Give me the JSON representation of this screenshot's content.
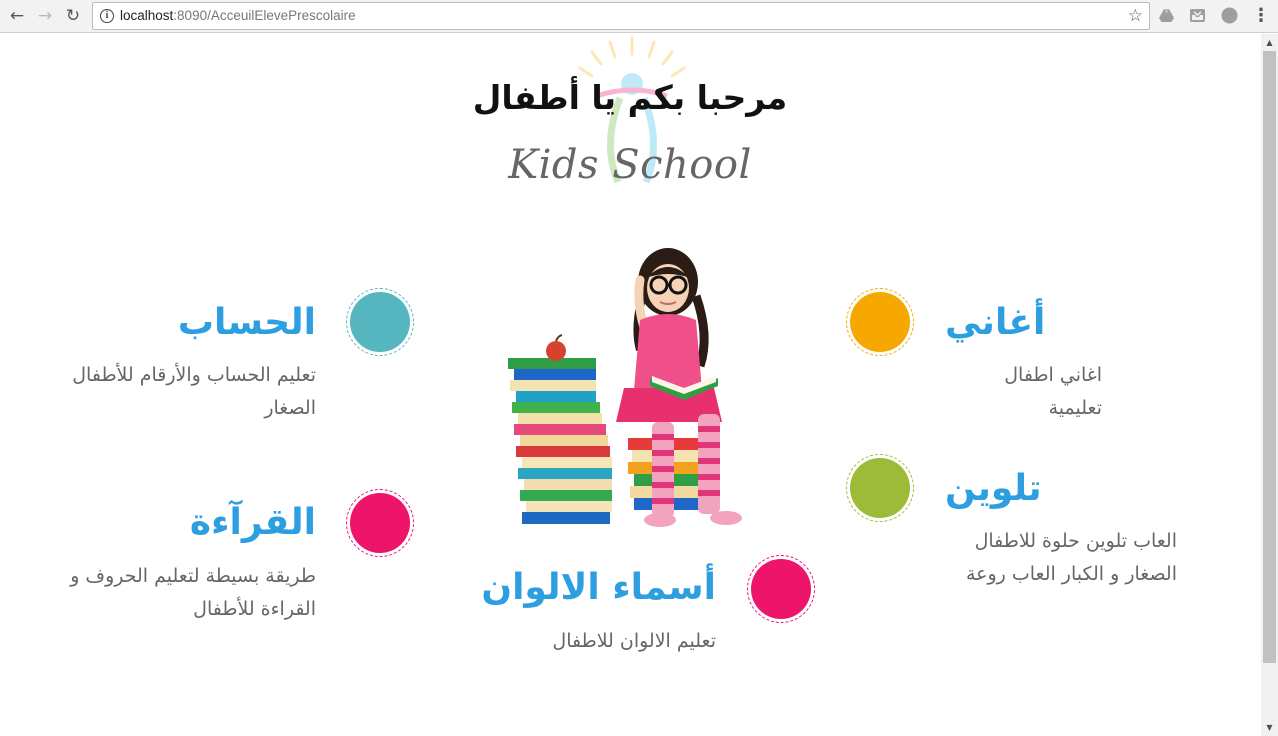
{
  "browser": {
    "url_host": "localhost",
    "url_path": ":8090/AcceuilElevePrescolaire"
  },
  "header": {
    "welcome": "مرحبا بكم يا أطفال",
    "brand": "Kids School"
  },
  "features": {
    "math": {
      "title": "الحساب",
      "desc_line1": "تعليم الحساب والأرقام للأطفال",
      "desc_line2": "الصغار",
      "color": "#56b6c0"
    },
    "reading": {
      "title": "القرآءة",
      "desc_line1": "طريقة بسيطة لتعليم الحروف و",
      "desc_line2": "القراءة للأطفال",
      "color": "#ee1469"
    },
    "songs": {
      "title": "أغاني",
      "desc_line1": "اغاني اطفال تعليمية",
      "color": "#f7a800"
    },
    "coloring": {
      "title": "تلوين",
      "desc_line1": "العاب تلوين حلوة للاطفال",
      "desc_line2": "الصغار و الكبار العاب روعة",
      "color": "#9dbb38"
    },
    "colors": {
      "title": "أسماء الالوان",
      "desc_line1": "تعليم الالوان للاطفال",
      "color": "#ee1469"
    }
  },
  "icons": {
    "back": "arrow-left-icon",
    "forward": "arrow-right-icon",
    "reload": "reload-icon",
    "info": "info-icon",
    "bookmark": "star-icon",
    "menu": "kebab-menu-icon"
  }
}
